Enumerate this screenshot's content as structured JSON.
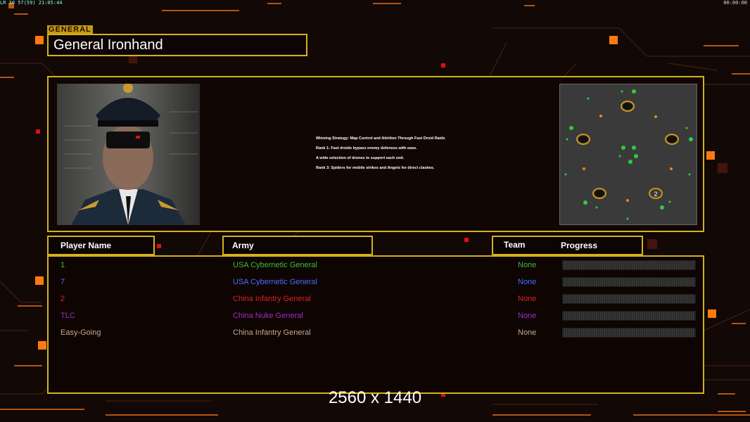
{
  "hud": {
    "fps": "LR 30 57(59) 21:05:44",
    "clock": "00:00:00"
  },
  "general": {
    "tag": "GENERAL",
    "name": "General Ironhand"
  },
  "strategy": [
    "Winning Strategy: Map Control and Attrition Through Fast Droid Raids",
    "Rank 1: Fast droids bypass enemy defenses with ease.",
    "A wide selection of drones to support each unit.",
    "Rank 3: Spiders for mobile strikes and Angels for direct clashes."
  ],
  "headers": {
    "player": "Player Name",
    "army": "Army",
    "team": "Team",
    "progress": "Progress"
  },
  "players": [
    {
      "name": "1",
      "army": "USA Cybernetic General",
      "team": "None",
      "color": "#3bbd3b",
      "progress": 0
    },
    {
      "name": "7",
      "army": "USA Cybernetic General",
      "team": "None",
      "color": "#4a6cff",
      "progress": 0
    },
    {
      "name": "2",
      "army": "China Infantry General",
      "team": "None",
      "color": "#e02020",
      "progress": 0
    },
    {
      "name": "TLC",
      "army": "China Nuke General",
      "team": "None",
      "color": "#9a2fc4",
      "progress": 0
    },
    {
      "name": "Easy-Going",
      "army": "China Infantry General",
      "team": "None",
      "color": "#c9a889",
      "progress": 0
    }
  ],
  "minimap": {
    "player_marker": "2"
  },
  "resolution": "2560 x 1440"
}
